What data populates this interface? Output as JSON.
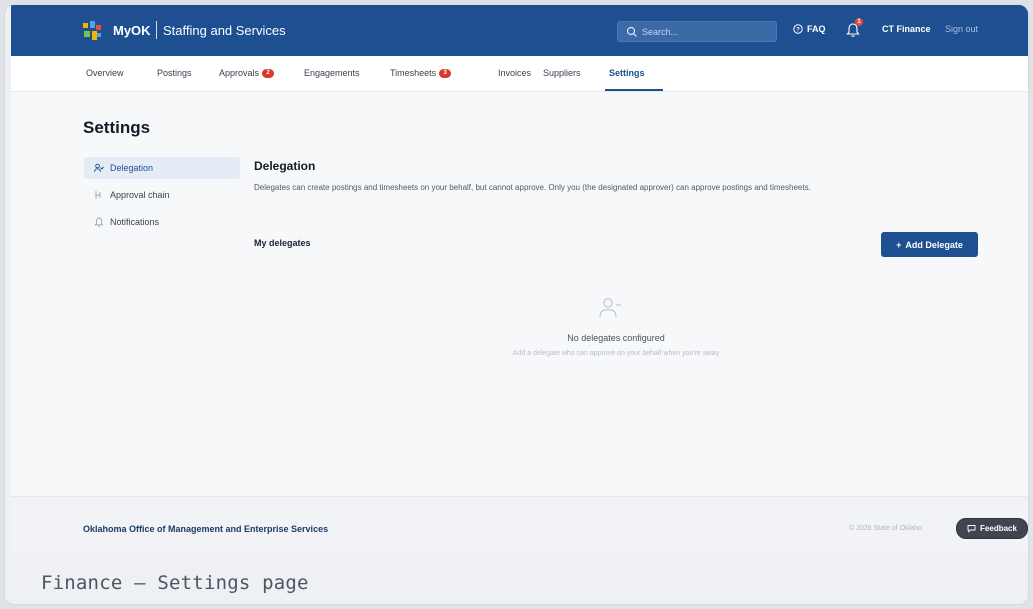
{
  "header": {
    "brand": "MyOK",
    "app_name": "Staffing and Services",
    "search_placeholder": "Search...",
    "faq_label": "FAQ",
    "notification_count": "1",
    "user_name": "CT Finance",
    "signout_label": "Sign out",
    "brand_color": "#1d4f91"
  },
  "tabs": [
    {
      "label": "Overview"
    },
    {
      "label": "Postings"
    },
    {
      "label": "Approvals",
      "badge": "2"
    },
    {
      "label": "Engagements"
    },
    {
      "label": "Timesheets",
      "badge": "3"
    },
    {
      "label": "Invoices"
    },
    {
      "label": "Suppliers"
    },
    {
      "label": "Settings",
      "active": true
    }
  ],
  "page": {
    "title": "Settings"
  },
  "sidebar": {
    "items": [
      {
        "label": "Delegation",
        "icon": "users-icon",
        "active": true
      },
      {
        "label": "Approval chain",
        "icon": "approval-chain-icon"
      },
      {
        "label": "Notifications",
        "icon": "bell-icon"
      }
    ]
  },
  "delegation": {
    "title": "Delegation",
    "description": "Delegates can create postings and timesheets on your behalf, but cannot approve. Only you (the designated approver) can approve postings and timesheets.",
    "subtitle": "My delegates",
    "add_button": "Add Delegate",
    "empty_title": "No delegates configured",
    "empty_desc": "Add a delegate who can approve on your behalf when you're away"
  },
  "footer": {
    "org": "Oklahoma Office of Management and Enterprise Services",
    "copyright": "© 2026 State of Oklaho"
  },
  "feedback_label": "Feedback",
  "caption": "Finance — Settings page"
}
